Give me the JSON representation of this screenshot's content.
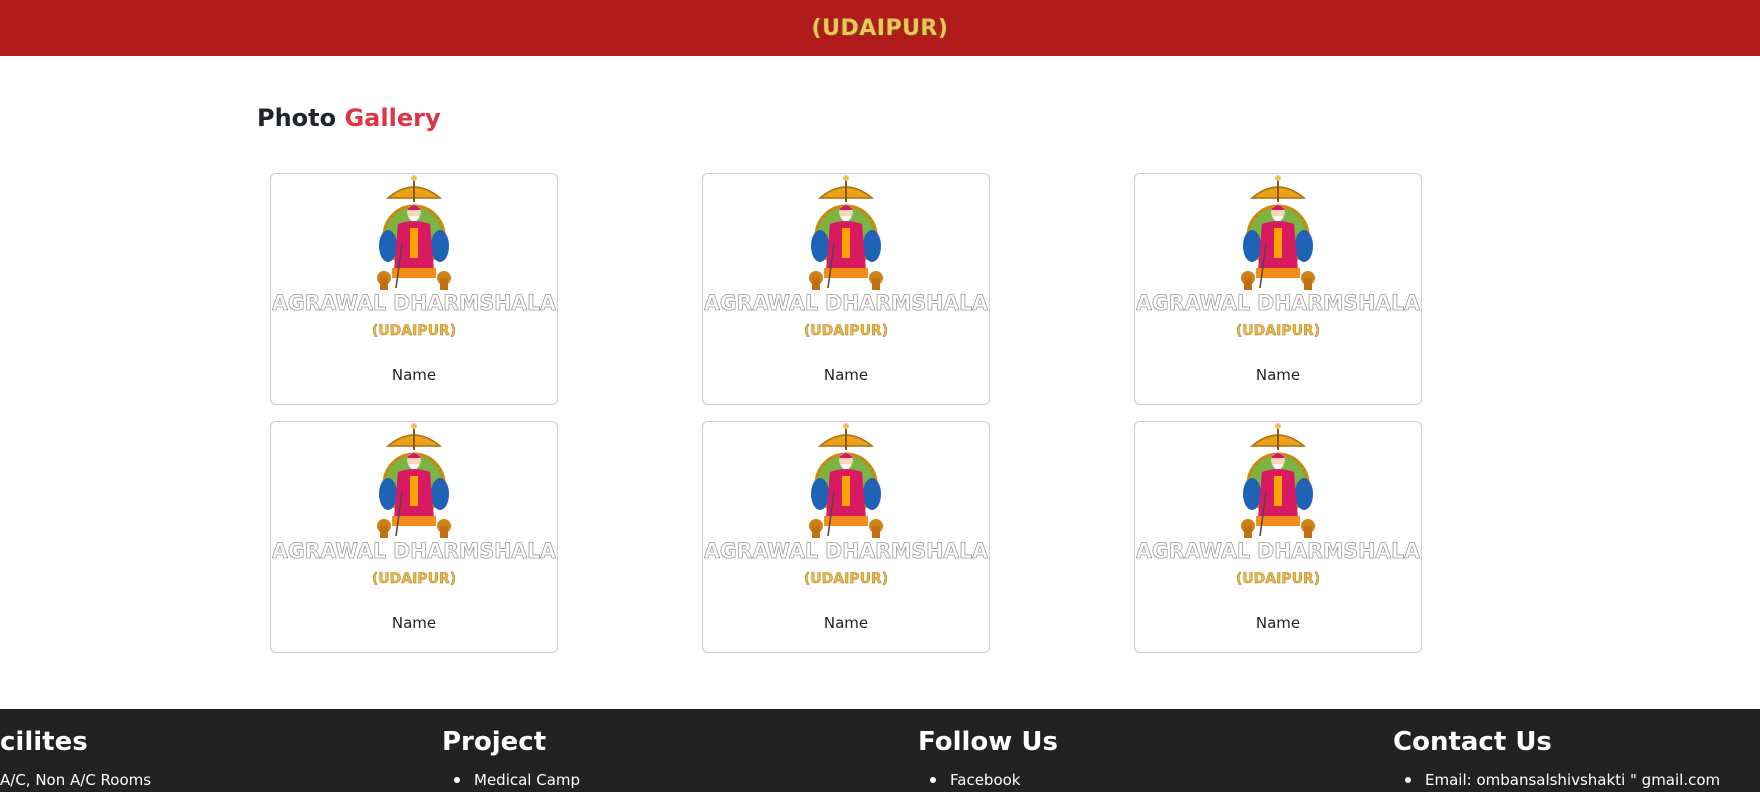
{
  "colors": {
    "banner_bg": "#b11b1c",
    "banner_text": "#f2c25c",
    "heading_accent": "#dc3545",
    "footer_bg": "#222222",
    "logo_text": "#ffffff",
    "logo_subtext": "#e8b84a"
  },
  "banner": {
    "text": "(UDAIPUR)"
  },
  "gallery": {
    "title_main": "Photo",
    "title_accent": "Gallery",
    "cards": [
      {
        "image_icon": "deity-logo-icon",
        "logo_title": "AGRAWAL DHARMSHALA",
        "logo_subtitle": "(UDAIPUR)",
        "name": "Name"
      },
      {
        "image_icon": "deity-logo-icon",
        "logo_title": "AGRAWAL DHARMSHALA",
        "logo_subtitle": "(UDAIPUR)",
        "name": "Name"
      },
      {
        "image_icon": "deity-logo-icon",
        "logo_title": "AGRAWAL DHARMSHALA",
        "logo_subtitle": "(UDAIPUR)",
        "name": "Name"
      },
      {
        "image_icon": "deity-logo-icon",
        "logo_title": "AGRAWAL DHARMSHALA",
        "logo_subtitle": "(UDAIPUR)",
        "name": "Name"
      },
      {
        "image_icon": "deity-logo-icon",
        "logo_title": "AGRAWAL DHARMSHALA",
        "logo_subtitle": "(UDAIPUR)",
        "name": "Name"
      },
      {
        "image_icon": "deity-logo-icon",
        "logo_title": "AGRAWAL DHARMSHALA",
        "logo_subtitle": "(UDAIPUR)",
        "name": "Name"
      }
    ]
  },
  "footer": {
    "facilities": {
      "title": "cilites",
      "items": [
        "A/C, Non A/C Rooms"
      ]
    },
    "project": {
      "title": "Project",
      "items": [
        "Medical Camp"
      ]
    },
    "follow_us": {
      "title": "Follow Us",
      "items": [
        "Facebook"
      ]
    },
    "contact_us": {
      "title": "Contact Us",
      "items": [
        "Email: ombansalshivshakti \" gmail.com"
      ]
    }
  }
}
